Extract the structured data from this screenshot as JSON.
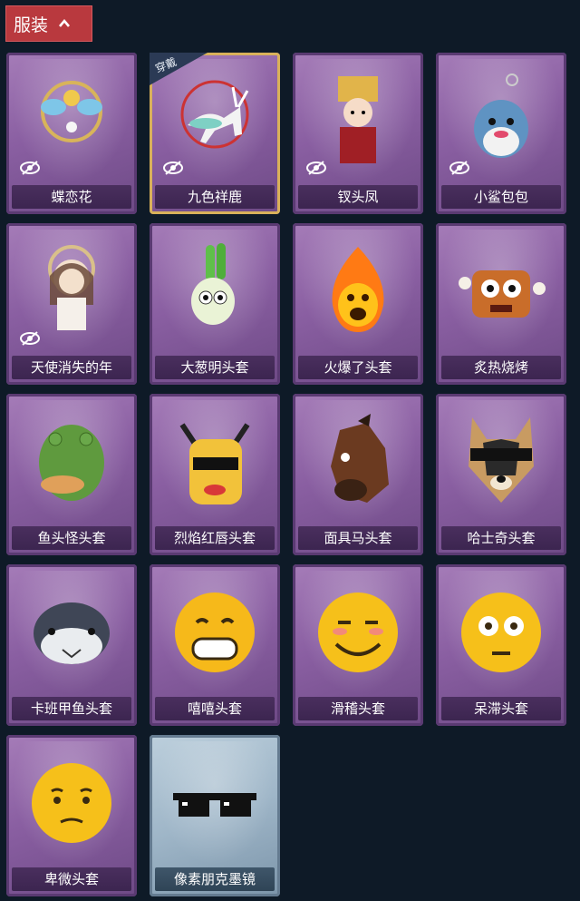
{
  "header": {
    "title": "服装"
  },
  "worn_label": "穿戴",
  "items": [
    {
      "name": "蝶恋花",
      "hidden": true,
      "worn": false,
      "style": "purple",
      "art": "butterfly-ornament"
    },
    {
      "name": "九色祥鹿",
      "hidden": true,
      "worn": true,
      "style": "purple",
      "art": "deer-ornament"
    },
    {
      "name": "钗头凤",
      "hidden": true,
      "worn": false,
      "style": "purple",
      "art": "phoenix-crown-figure"
    },
    {
      "name": "小鲨包包",
      "hidden": true,
      "worn": false,
      "style": "purple",
      "art": "shark-keychain"
    },
    {
      "name": "天使消失的年",
      "hidden": true,
      "worn": false,
      "style": "purple",
      "art": "angel-figure"
    },
    {
      "name": "大葱明头套",
      "hidden": false,
      "worn": false,
      "style": "purple",
      "art": "scallion-head"
    },
    {
      "name": "火爆了头套",
      "hidden": false,
      "worn": false,
      "style": "purple",
      "art": "fire-head"
    },
    {
      "name": "炙热烧烤",
      "hidden": false,
      "worn": false,
      "style": "purple",
      "art": "meat-head"
    },
    {
      "name": "鱼头怪头套",
      "hidden": false,
      "worn": false,
      "style": "purple",
      "art": "fish-head"
    },
    {
      "name": "烈焰红唇头套",
      "hidden": false,
      "worn": false,
      "style": "purple",
      "art": "yellow-lips-head"
    },
    {
      "name": "面具马头套",
      "hidden": false,
      "worn": false,
      "style": "purple",
      "art": "horse-head"
    },
    {
      "name": "哈士奇头套",
      "hidden": false,
      "worn": false,
      "style": "purple",
      "art": "husky-head"
    },
    {
      "name": "卡班甲鱼头套",
      "hidden": false,
      "worn": false,
      "style": "purple",
      "art": "fish-round-head"
    },
    {
      "name": "嘻嘻头套",
      "hidden": false,
      "worn": false,
      "style": "purple",
      "art": "grin-emoji"
    },
    {
      "name": "滑稽头套",
      "hidden": false,
      "worn": false,
      "style": "purple",
      "art": "smirk-emoji"
    },
    {
      "name": "呆滞头套",
      "hidden": false,
      "worn": false,
      "style": "purple",
      "art": "flushed-emoji"
    },
    {
      "name": "卑微头套",
      "hidden": false,
      "worn": false,
      "style": "purple",
      "art": "humble-emoji"
    },
    {
      "name": "像素朋克墨镜",
      "hidden": false,
      "worn": false,
      "style": "blue",
      "art": "pixel-sunglasses"
    }
  ]
}
